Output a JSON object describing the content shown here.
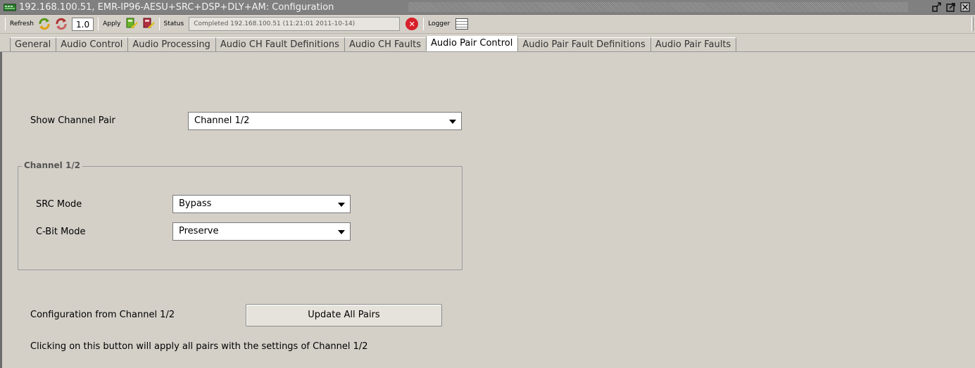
{
  "window": {
    "title": "192.168.100.51, EMR-IP96-AESU+SRC+DSP+DLY+AM: Configuration"
  },
  "toolbar": {
    "refresh_label": "Refresh",
    "version": "1.0",
    "apply_label": "Apply",
    "status_label": "Status",
    "status_text": "Completed 192.168.100.51 (11:21:01  2011-10-14)",
    "logger_label": "Logger"
  },
  "tabs": [
    {
      "label": "General"
    },
    {
      "label": "Audio Control"
    },
    {
      "label": "Audio Processing"
    },
    {
      "label": "Audio CH Fault Definitions"
    },
    {
      "label": "Audio CH Faults"
    },
    {
      "label": "Audio Pair Control",
      "active": true
    },
    {
      "label": "Audio Pair Fault Definitions"
    },
    {
      "label": "Audio Pair Faults"
    }
  ],
  "main": {
    "show_channel_pair_label": "Show Channel Pair",
    "show_channel_pair_value": "Channel 1/2",
    "group_title": "Channel 1/2",
    "src_mode_label": "SRC Mode",
    "src_mode_value": "Bypass",
    "cbit_mode_label": "C-Bit Mode",
    "cbit_mode_value": "Preserve",
    "config_from_label": "Configuration from  Channel 1/2",
    "update_button": "Update All Pairs",
    "info_text": "Clicking on this button will apply all pairs with the settings of  Channel 1/2"
  },
  "colors": {
    "title_bg": "#808080",
    "panel_bg": "#d4d0c8",
    "error_red": "#d8202a"
  }
}
